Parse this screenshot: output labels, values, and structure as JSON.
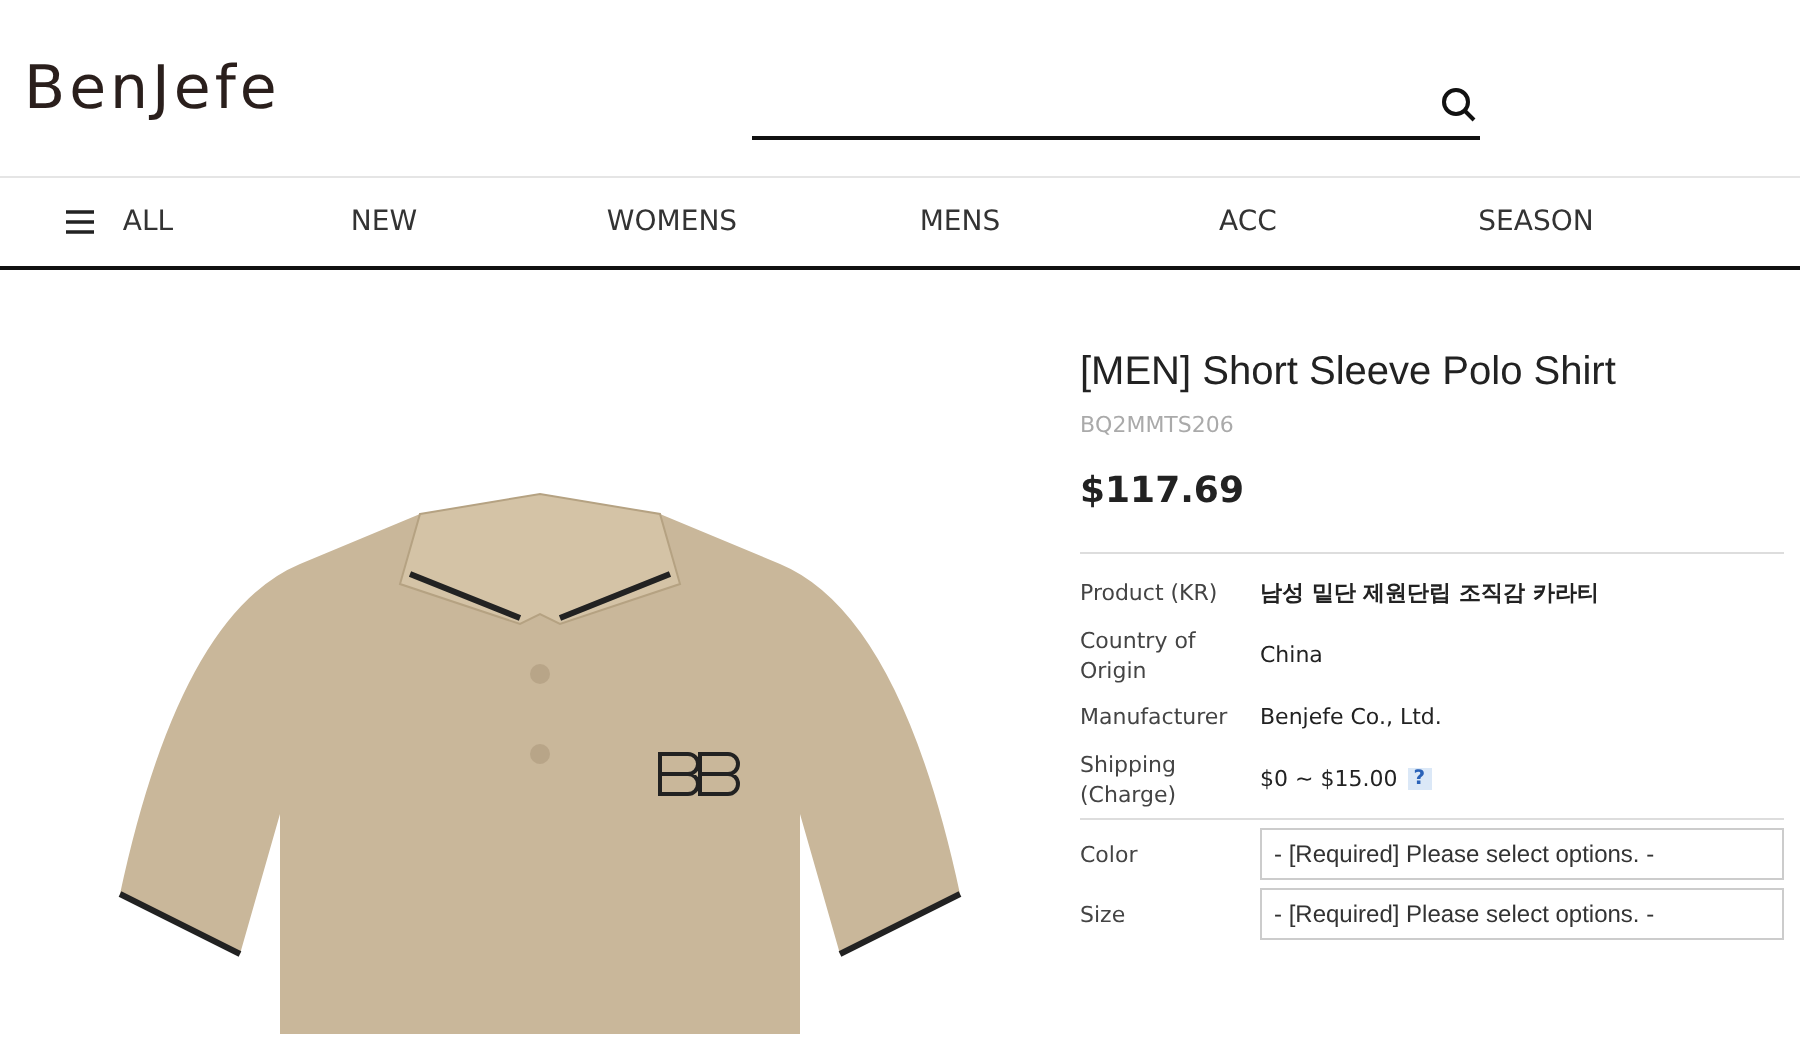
{
  "logo": "BenJefe",
  "nav": [
    {
      "label": "ALL",
      "kind": "menu"
    },
    {
      "label": "NEW",
      "kind": "link"
    },
    {
      "label": "WOMENS",
      "kind": "link"
    },
    {
      "label": "MENS",
      "kind": "link"
    },
    {
      "label": "ACC",
      "kind": "link"
    },
    {
      "label": "SEASON",
      "kind": "link"
    }
  ],
  "product": {
    "title": "[MEN] Short Sleeve Polo Shirt",
    "code": "BQ2MMTS206",
    "price": "$117.69"
  },
  "details": [
    {
      "label": "Product (KR)",
      "value": "남성 밑단 제원단립 조직감 카라티",
      "kind": "bold"
    },
    {
      "label": "Country of Origin",
      "value": "China",
      "kind": "text"
    },
    {
      "label": "Manufacturer",
      "value": "Benjefe Co., Ltd.",
      "kind": "text"
    },
    {
      "label": "Shipping (Charge)",
      "value": "$0 ~ $15.00",
      "kind": "help",
      "help": "?"
    }
  ],
  "options": [
    {
      "label": "Color",
      "value": "- [Required] Please select options. -"
    },
    {
      "label": "Size",
      "value": "- [Required] Please select options. -"
    }
  ]
}
